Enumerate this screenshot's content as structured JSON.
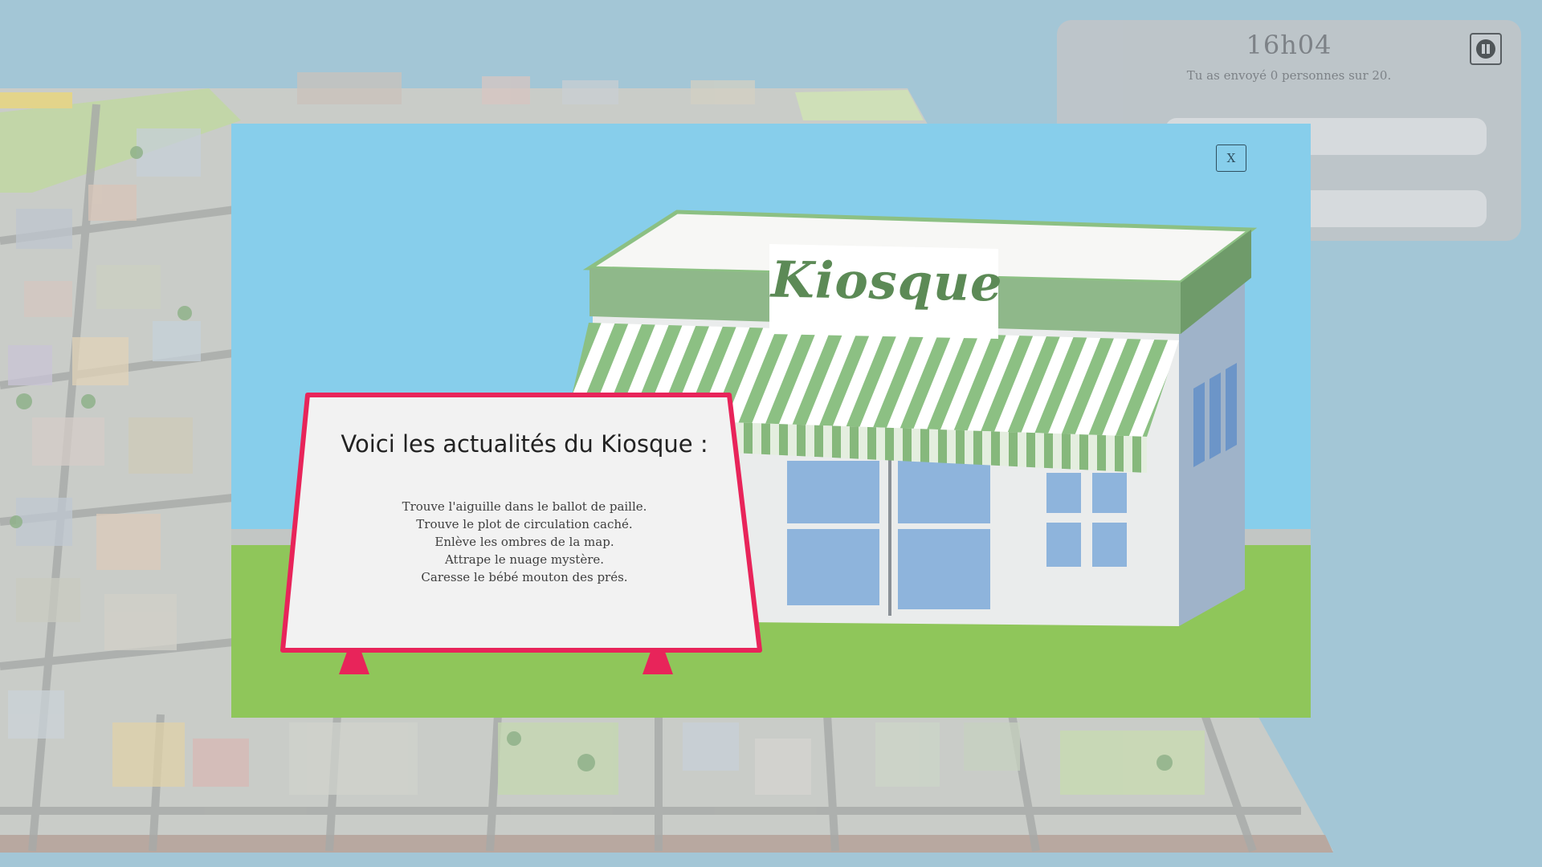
{
  "hud": {
    "time": "16h04",
    "status": "Tu as envoyé 0 personnes sur 20.",
    "pause_icon": "pause-icon"
  },
  "modal": {
    "close_label": "X",
    "shop_sign": "Kiosque",
    "board": {
      "title": "Voici les actualités du Kiosque :",
      "items": [
        "Trouve l'aiguille dans le ballot de paille.",
        "Trouve le plot de circulation caché.",
        "Enlève les ombres de la map.",
        "Attrape le nuage mystère.",
        "Caresse le bébé mouton des prés."
      ]
    }
  },
  "colors": {
    "sky": "#87ceeb",
    "grass": "#8fc65a",
    "awning_green": "#8cc083",
    "sign_border": "#e8245a",
    "background": "#a3c6d6"
  }
}
